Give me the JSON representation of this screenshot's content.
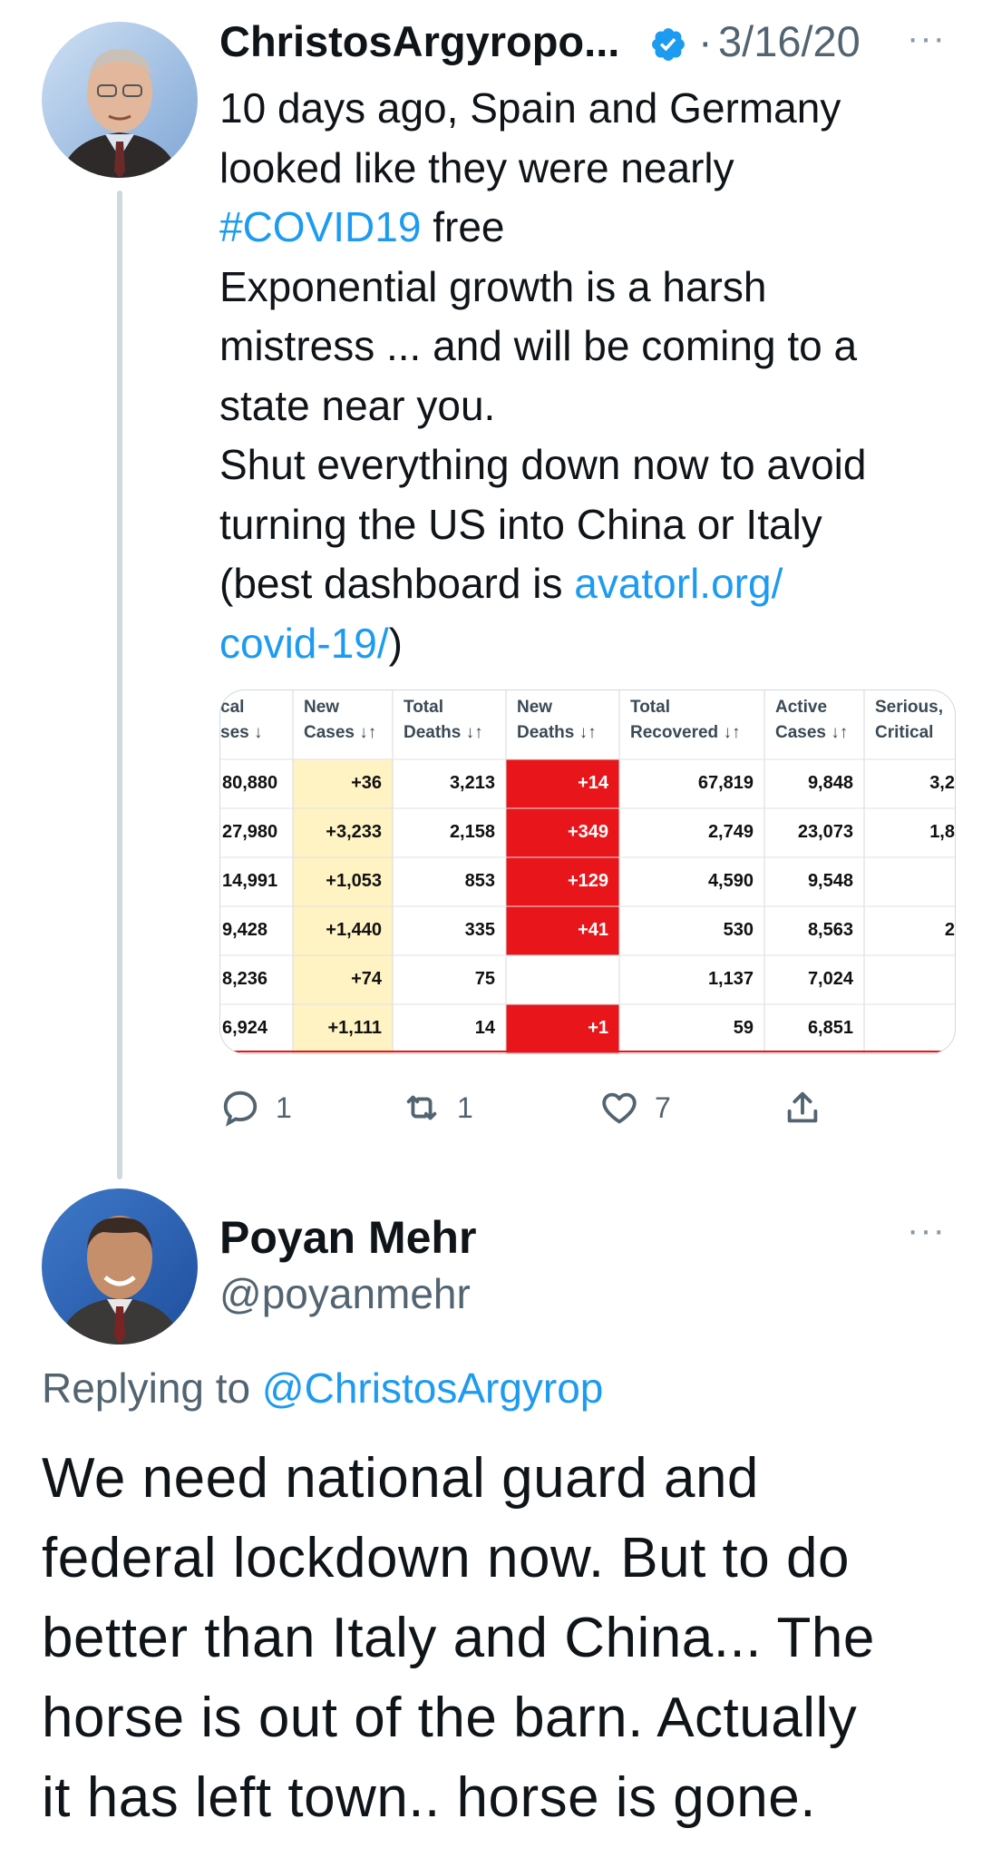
{
  "tweet": {
    "author_name": "ChristosArgyropo...",
    "separator": "·",
    "date": "3/16/20",
    "more": "···",
    "lines": [
      {
        "parts": [
          {
            "t": "10 days ago, Spain and Germany",
            "link": false
          }
        ]
      },
      {
        "parts": [
          {
            "t": "looked like they were nearly",
            "link": false
          }
        ]
      },
      {
        "parts": [
          {
            "t": "#COVID19",
            "link": true
          },
          {
            "t": " free",
            "link": false
          }
        ]
      },
      {
        "parts": [
          {
            "t": "Exponential growth is a harsh",
            "link": false
          }
        ]
      },
      {
        "parts": [
          {
            "t": "mistress ... and will be coming to a",
            "link": false
          }
        ]
      },
      {
        "parts": [
          {
            "t": "state near you.",
            "link": false
          }
        ]
      },
      {
        "parts": [
          {
            "t": "Shut everything down now to avoid",
            "link": false
          }
        ]
      },
      {
        "parts": [
          {
            "t": "turning the US into China or Italy",
            "link": false
          }
        ]
      },
      {
        "parts": [
          {
            "t": "(best dashboard is ",
            "link": false
          },
          {
            "t": "avatorl.org/",
            "link": true
          }
        ]
      },
      {
        "parts": [
          {
            "t": "covid-19/",
            "link": true
          },
          {
            "t": ")",
            "link": false
          }
        ]
      }
    ],
    "table": {
      "headers": [
        [
          "cal",
          "ses ↓"
        ],
        [
          "New",
          "Cases ↓↑"
        ],
        [
          "Total",
          "Deaths ↓↑"
        ],
        [
          "New",
          "Deaths ↓↑"
        ],
        [
          "Total",
          "Recovered ↓↑"
        ],
        [
          "Active",
          "Cases ↓↑"
        ],
        [
          "Serious,",
          "Critical"
        ]
      ],
      "rows": [
        [
          "80,880",
          "+36",
          "3,213",
          "+14",
          "67,819",
          "9,848",
          "3,2"
        ],
        [
          "27,980",
          "+3,233",
          "2,158",
          "+349",
          "2,749",
          "23,073",
          "1,8"
        ],
        [
          "14,991",
          "+1,053",
          "853",
          "+129",
          "4,590",
          "9,548",
          ""
        ],
        [
          "9,428",
          "+1,440",
          "335",
          "+41",
          "530",
          "8,563",
          "2"
        ],
        [
          "8,236",
          "+74",
          "75",
          "",
          "1,137",
          "7,024",
          ""
        ],
        [
          "6,924",
          "+1,111",
          "14",
          "+1",
          "59",
          "6,851",
          ""
        ]
      ],
      "colors": {
        "new_cases_bg": "#fff3c4",
        "new_deaths_bg": "#e8161b",
        "header_text": "#3b4a55",
        "cell_text": "#111111"
      }
    },
    "actions": {
      "reply_icon": "comment-icon",
      "reply_count": "1",
      "retweet_icon": "retweet-icon",
      "retweet_count": "1",
      "like_icon": "heart-icon",
      "like_count": "7",
      "share_icon": "share-icon"
    }
  },
  "reply": {
    "author_name": "Poyan Mehr",
    "handle": "@poyanmehr",
    "more": "···",
    "replying_prefix": "Replying to ",
    "replying_handle": "@ChristosArgyrop",
    "lines": [
      "We need national guard and",
      "federal lockdown now. But to do",
      "better than Italy and China... The",
      "horse is out of the barn. Actually",
      "it has left town.. horse is gone."
    ]
  },
  "colors": {
    "link": "#1d9bf0",
    "verified": "#1d9bf0",
    "secondary": "#536471",
    "thread_line": "#cfd9de"
  }
}
